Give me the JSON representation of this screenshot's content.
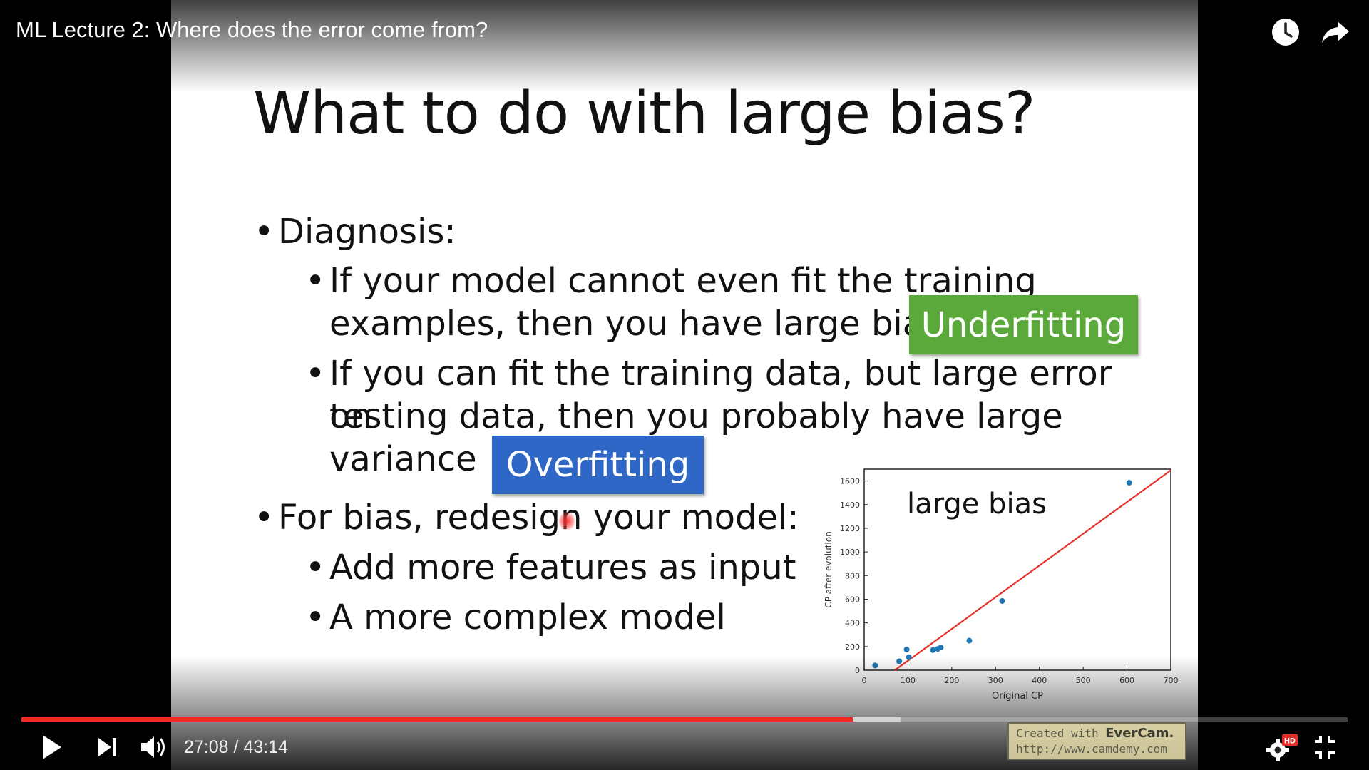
{
  "video": {
    "title": "ML Lecture 2: Where does the error come from?",
    "current_time": "27:08",
    "duration": "43:14",
    "time_separator": "/",
    "progress_fraction": 0.627,
    "buffered_fraction": 0.663,
    "quality_badge": "HD",
    "colors": {
      "progress": "#f12b24"
    }
  },
  "slide": {
    "title": "What to do with large bias?",
    "diagnosis": "Diagnosis:",
    "underfit_line1": "If your model cannot even fit the training",
    "underfit_line2": "examples, then you have large bias",
    "overfit_line1": "If you can fit the training data, but large error on",
    "overfit_line2": "testing data, then you probably have large",
    "overfit_line3": "variance",
    "underfitting_tag": "Underfitting",
    "overfitting_tag": "Overfitting",
    "for_bias": "For bias, redesign your model:",
    "add_features": "Add more features as input",
    "complex_model": "A more complex model"
  },
  "chart_data": {
    "type": "scatter",
    "annotation": "large bias",
    "xlabel": "Original CP",
    "ylabel": "CP after evolution",
    "xlim": [
      0,
      700
    ],
    "ylim": [
      0,
      1700
    ],
    "xticks": [
      0,
      100,
      200,
      300,
      400,
      500,
      600,
      700
    ],
    "yticks": [
      0,
      200,
      400,
      600,
      800,
      1000,
      1200,
      1400,
      1600
    ],
    "points": [
      {
        "x": 25,
        "y": 40
      },
      {
        "x": 80,
        "y": 75
      },
      {
        "x": 97,
        "y": 175
      },
      {
        "x": 102,
        "y": 110
      },
      {
        "x": 157,
        "y": 170
      },
      {
        "x": 168,
        "y": 180
      },
      {
        "x": 175,
        "y": 192
      },
      {
        "x": 240,
        "y": 250
      },
      {
        "x": 315,
        "y": 585
      },
      {
        "x": 605,
        "y": 1585
      }
    ],
    "fit_line": {
      "x": [
        70,
        700
      ],
      "y": [
        0,
        1690
      ]
    },
    "colors": {
      "points": "#1f77b4",
      "line": "#e8322a"
    }
  },
  "watermark": {
    "line1_prefix": "Created with ",
    "line1_brand": "EverCam.",
    "line2": "http://www.camdemy.com"
  }
}
